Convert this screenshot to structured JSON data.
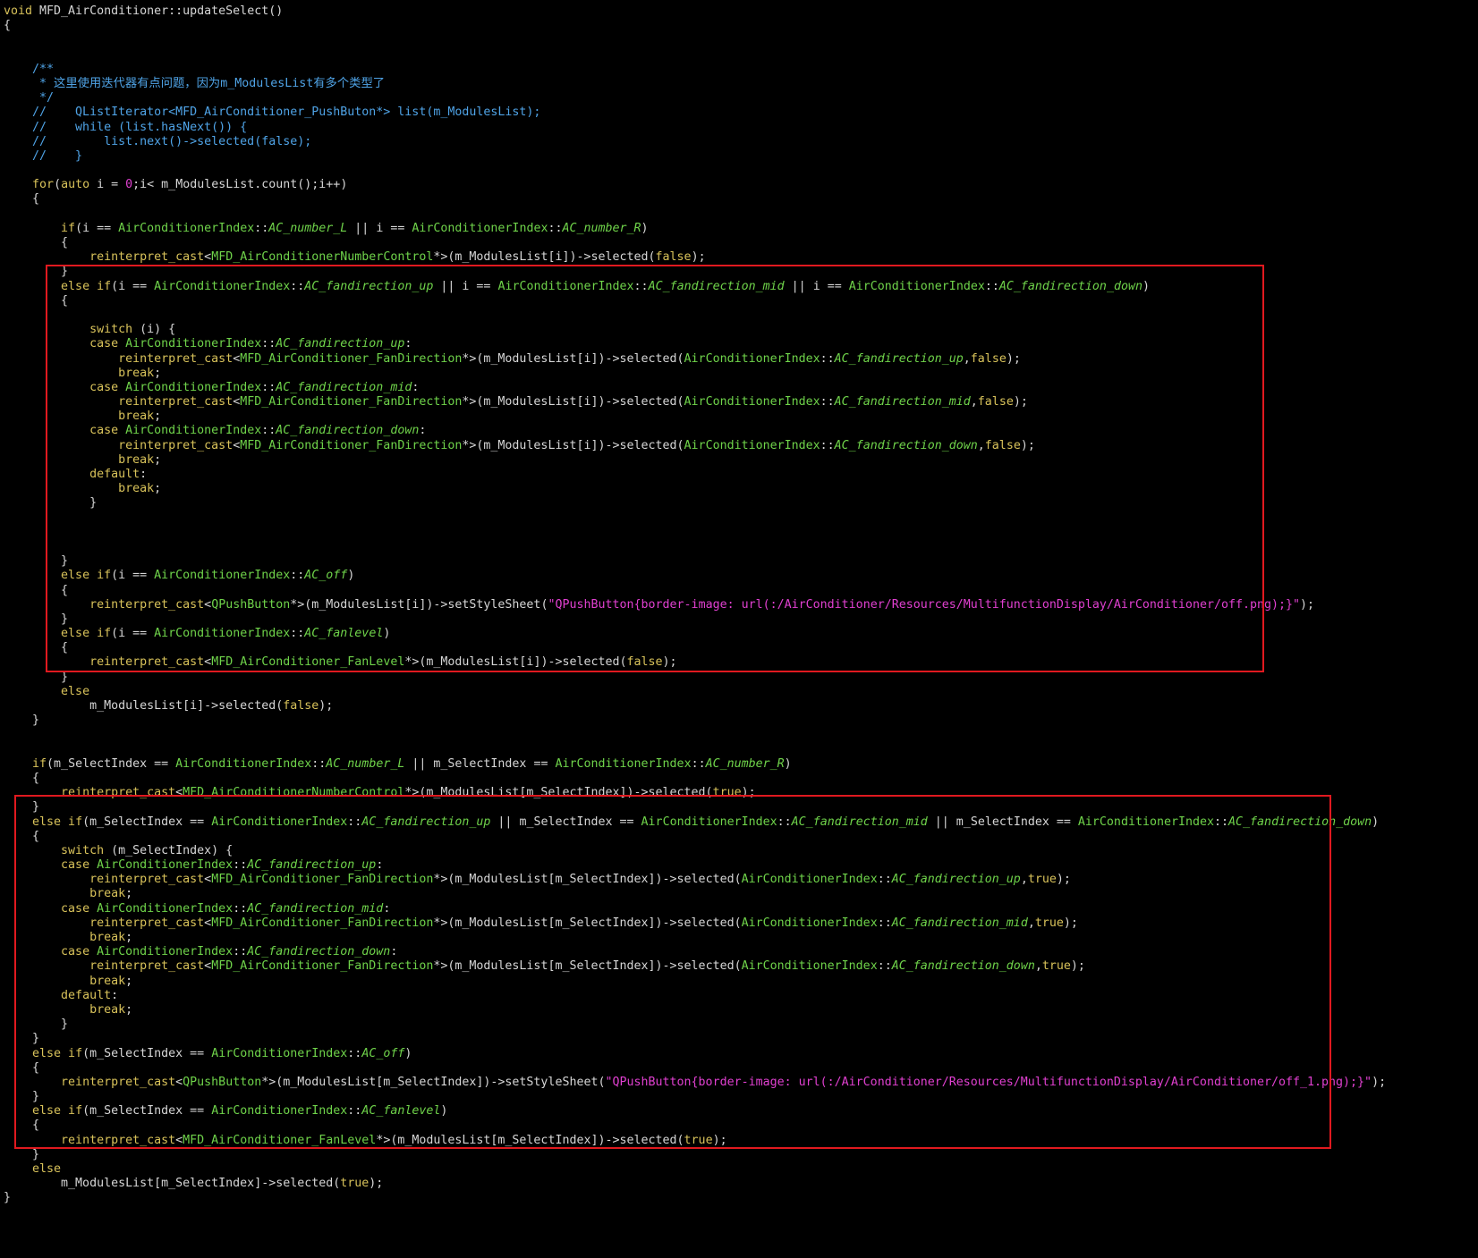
{
  "colors": {
    "background": "#000000",
    "highlight": "#e0191f",
    "keyword": "#d8c25a",
    "type": "#6fd34a",
    "comment": "#4fa3e6",
    "string": "#e040d0",
    "plain": "#d6d6d6"
  },
  "lines": [
    [
      [
        "kw",
        "void "
      ],
      [
        "pl",
        "MFD_AirConditioner::updateSelect()"
      ]
    ],
    [
      [
        "pl",
        "{"
      ]
    ],
    [],
    [],
    [
      [
        "cm",
        "    /**"
      ]
    ],
    [
      [
        "cm",
        "     * 这里使用迭代器有点问题，因为m_ModulesList有多个类型了"
      ]
    ],
    [
      [
        "cm",
        "     */"
      ]
    ],
    [
      [
        "cm",
        "    //    QListIterator<MFD_AirConditioner_PushButon*> list(m_ModulesList);"
      ]
    ],
    [
      [
        "cm",
        "    //    while (list.hasNext()) {"
      ]
    ],
    [
      [
        "cm",
        "    //        list.next()->selected(false);"
      ]
    ],
    [
      [
        "cm",
        "    //    }"
      ]
    ],
    [],
    [
      [
        "pl",
        "    "
      ],
      [
        "kw",
        "for"
      ],
      [
        "pl",
        "("
      ],
      [
        "kw",
        "auto "
      ],
      [
        "pl",
        "i = "
      ],
      [
        "nm",
        "0"
      ],
      [
        "pl",
        ";i< m_ModulesList.count();i++)"
      ]
    ],
    [
      [
        "pl",
        "    {"
      ]
    ],
    [],
    [
      [
        "pl",
        "        "
      ],
      [
        "kw",
        "if"
      ],
      [
        "pl",
        "(i == "
      ],
      [
        "ty",
        "AirConditionerIndex"
      ],
      [
        "pl",
        "::"
      ],
      [
        "it",
        "AC_number_L"
      ],
      [
        "pl",
        " || i == "
      ],
      [
        "ty",
        "AirConditionerIndex"
      ],
      [
        "pl",
        "::"
      ],
      [
        "it",
        "AC_number_R"
      ],
      [
        "pl",
        ")"
      ]
    ],
    [
      [
        "pl",
        "        {"
      ]
    ],
    [
      [
        "pl",
        "            "
      ],
      [
        "kw",
        "reinterpret_cast"
      ],
      [
        "pl",
        "<"
      ],
      [
        "ty",
        "MFD_AirConditionerNumberControl"
      ],
      [
        "pl",
        "*>(m_ModulesList[i])->selected("
      ],
      [
        "kw",
        "false"
      ],
      [
        "pl",
        ");"
      ]
    ],
    [
      [
        "pl",
        "        }"
      ]
    ],
    [
      [
        "pl",
        "        "
      ],
      [
        "kw",
        "else if"
      ],
      [
        "pl",
        "(i == "
      ],
      [
        "ty",
        "AirConditionerIndex"
      ],
      [
        "pl",
        "::"
      ],
      [
        "it",
        "AC_fandirection_up"
      ],
      [
        "pl",
        " || i == "
      ],
      [
        "ty",
        "AirConditionerIndex"
      ],
      [
        "pl",
        "::"
      ],
      [
        "it",
        "AC_fandirection_mid"
      ],
      [
        "pl",
        " || i == "
      ],
      [
        "ty",
        "AirConditionerIndex"
      ],
      [
        "pl",
        "::"
      ],
      [
        "it",
        "AC_fandirection_down"
      ],
      [
        "pl",
        ")"
      ]
    ],
    [
      [
        "pl",
        "        {"
      ]
    ],
    [],
    [
      [
        "pl",
        "            "
      ],
      [
        "kw",
        "switch"
      ],
      [
        "pl",
        " (i) {"
      ]
    ],
    [
      [
        "pl",
        "            "
      ],
      [
        "kw",
        "case "
      ],
      [
        "ty",
        "AirConditionerIndex"
      ],
      [
        "pl",
        "::"
      ],
      [
        "it",
        "AC_fandirection_up"
      ],
      [
        "pl",
        ":"
      ]
    ],
    [
      [
        "pl",
        "                "
      ],
      [
        "kw",
        "reinterpret_cast"
      ],
      [
        "pl",
        "<"
      ],
      [
        "ty",
        "MFD_AirConditioner_FanDirection"
      ],
      [
        "pl",
        "*>(m_ModulesList[i])->selected("
      ],
      [
        "ty",
        "AirConditionerIndex"
      ],
      [
        "pl",
        "::"
      ],
      [
        "it",
        "AC_fandirection_up"
      ],
      [
        "pl",
        ","
      ],
      [
        "kw",
        "false"
      ],
      [
        "pl",
        ");"
      ]
    ],
    [
      [
        "pl",
        "                "
      ],
      [
        "kw",
        "break"
      ],
      [
        "pl",
        ";"
      ]
    ],
    [
      [
        "pl",
        "            "
      ],
      [
        "kw",
        "case "
      ],
      [
        "ty",
        "AirConditionerIndex"
      ],
      [
        "pl",
        "::"
      ],
      [
        "it",
        "AC_fandirection_mid"
      ],
      [
        "pl",
        ":"
      ]
    ],
    [
      [
        "pl",
        "                "
      ],
      [
        "kw",
        "reinterpret_cast"
      ],
      [
        "pl",
        "<"
      ],
      [
        "ty",
        "MFD_AirConditioner_FanDirection"
      ],
      [
        "pl",
        "*>(m_ModulesList[i])->selected("
      ],
      [
        "ty",
        "AirConditionerIndex"
      ],
      [
        "pl",
        "::"
      ],
      [
        "it",
        "AC_fandirection_mid"
      ],
      [
        "pl",
        ","
      ],
      [
        "kw",
        "false"
      ],
      [
        "pl",
        ");"
      ]
    ],
    [
      [
        "pl",
        "                "
      ],
      [
        "kw",
        "break"
      ],
      [
        "pl",
        ";"
      ]
    ],
    [
      [
        "pl",
        "            "
      ],
      [
        "kw",
        "case "
      ],
      [
        "ty",
        "AirConditionerIndex"
      ],
      [
        "pl",
        "::"
      ],
      [
        "it",
        "AC_fandirection_down"
      ],
      [
        "pl",
        ":"
      ]
    ],
    [
      [
        "pl",
        "                "
      ],
      [
        "kw",
        "reinterpret_cast"
      ],
      [
        "pl",
        "<"
      ],
      [
        "ty",
        "MFD_AirConditioner_FanDirection"
      ],
      [
        "pl",
        "*>(m_ModulesList[i])->selected("
      ],
      [
        "ty",
        "AirConditionerIndex"
      ],
      [
        "pl",
        "::"
      ],
      [
        "it",
        "AC_fandirection_down"
      ],
      [
        "pl",
        ","
      ],
      [
        "kw",
        "false"
      ],
      [
        "pl",
        ");"
      ]
    ],
    [
      [
        "pl",
        "                "
      ],
      [
        "kw",
        "break"
      ],
      [
        "pl",
        ";"
      ]
    ],
    [
      [
        "pl",
        "            "
      ],
      [
        "kw",
        "default"
      ],
      [
        "pl",
        ":"
      ]
    ],
    [
      [
        "pl",
        "                "
      ],
      [
        "kw",
        "break"
      ],
      [
        "pl",
        ";"
      ]
    ],
    [
      [
        "pl",
        "            }"
      ]
    ],
    [],
    [],
    [],
    [
      [
        "pl",
        "        }"
      ]
    ],
    [
      [
        "pl",
        "        "
      ],
      [
        "kw",
        "else if"
      ],
      [
        "pl",
        "(i == "
      ],
      [
        "ty",
        "AirConditionerIndex"
      ],
      [
        "pl",
        "::"
      ],
      [
        "it",
        "AC_off"
      ],
      [
        "pl",
        ")"
      ]
    ],
    [
      [
        "pl",
        "        {"
      ]
    ],
    [
      [
        "pl",
        "            "
      ],
      [
        "kw",
        "reinterpret_cast"
      ],
      [
        "pl",
        "<"
      ],
      [
        "ty",
        "QPushButton"
      ],
      [
        "pl",
        "*>(m_ModulesList[i])->setStyleSheet("
      ],
      [
        "st",
        "\"QPushButton{border-image: url(:/AirConditioner/Resources/MultifunctionDisplay/AirConditioner/off.png);}\""
      ],
      [
        "pl",
        ");"
      ]
    ],
    [
      [
        "pl",
        "        }"
      ]
    ],
    [
      [
        "pl",
        "        "
      ],
      [
        "kw",
        "else if"
      ],
      [
        "pl",
        "(i == "
      ],
      [
        "ty",
        "AirConditionerIndex"
      ],
      [
        "pl",
        "::"
      ],
      [
        "it",
        "AC_fanlevel"
      ],
      [
        "pl",
        ")"
      ]
    ],
    [
      [
        "pl",
        "        {"
      ]
    ],
    [
      [
        "pl",
        "            "
      ],
      [
        "kw",
        "reinterpret_cast"
      ],
      [
        "pl",
        "<"
      ],
      [
        "ty",
        "MFD_AirConditioner_FanLevel"
      ],
      [
        "pl",
        "*>(m_ModulesList[i])->selected("
      ],
      [
        "kw",
        "false"
      ],
      [
        "pl",
        ");"
      ]
    ],
    [
      [
        "pl",
        "        }"
      ]
    ],
    [
      [
        "pl",
        "        "
      ],
      [
        "kw",
        "else"
      ]
    ],
    [
      [
        "pl",
        "            m_ModulesList[i]->selected("
      ],
      [
        "kw",
        "false"
      ],
      [
        "pl",
        ");"
      ]
    ],
    [
      [
        "pl",
        "    }"
      ]
    ],
    [],
    [],
    [
      [
        "pl",
        "    "
      ],
      [
        "kw",
        "if"
      ],
      [
        "pl",
        "(m_SelectIndex == "
      ],
      [
        "ty",
        "AirConditionerIndex"
      ],
      [
        "pl",
        "::"
      ],
      [
        "it",
        "AC_number_L"
      ],
      [
        "pl",
        " || m_SelectIndex == "
      ],
      [
        "ty",
        "AirConditionerIndex"
      ],
      [
        "pl",
        "::"
      ],
      [
        "it",
        "AC_number_R"
      ],
      [
        "pl",
        ")"
      ]
    ],
    [
      [
        "pl",
        "    {"
      ]
    ],
    [
      [
        "pl",
        "        "
      ],
      [
        "kw",
        "reinterpret_cast"
      ],
      [
        "pl",
        "<"
      ],
      [
        "ty",
        "MFD_AirConditionerNumberControl"
      ],
      [
        "pl",
        "*>(m_ModulesList[m_SelectIndex])->selected("
      ],
      [
        "kw",
        "true"
      ],
      [
        "pl",
        ");"
      ]
    ],
    [
      [
        "pl",
        "    }"
      ]
    ],
    [
      [
        "pl",
        "    "
      ],
      [
        "kw",
        "else if"
      ],
      [
        "pl",
        "(m_SelectIndex == "
      ],
      [
        "ty",
        "AirConditionerIndex"
      ],
      [
        "pl",
        "::"
      ],
      [
        "it",
        "AC_fandirection_up"
      ],
      [
        "pl",
        " || m_SelectIndex == "
      ],
      [
        "ty",
        "AirConditionerIndex"
      ],
      [
        "pl",
        "::"
      ],
      [
        "it",
        "AC_fandirection_mid"
      ],
      [
        "pl",
        " || m_SelectIndex == "
      ],
      [
        "ty",
        "AirConditionerIndex"
      ],
      [
        "pl",
        "::"
      ],
      [
        "it",
        "AC_fandirection_down"
      ],
      [
        "pl",
        ")"
      ]
    ],
    [
      [
        "pl",
        "    {"
      ]
    ],
    [
      [
        "pl",
        "        "
      ],
      [
        "kw",
        "switch"
      ],
      [
        "pl",
        " (m_SelectIndex) {"
      ]
    ],
    [
      [
        "pl",
        "        "
      ],
      [
        "kw",
        "case "
      ],
      [
        "ty",
        "AirConditionerIndex"
      ],
      [
        "pl",
        "::"
      ],
      [
        "it",
        "AC_fandirection_up"
      ],
      [
        "pl",
        ":"
      ]
    ],
    [
      [
        "pl",
        "            "
      ],
      [
        "kw",
        "reinterpret_cast"
      ],
      [
        "pl",
        "<"
      ],
      [
        "ty",
        "MFD_AirConditioner_FanDirection"
      ],
      [
        "pl",
        "*>(m_ModulesList[m_SelectIndex])->selected("
      ],
      [
        "ty",
        "AirConditionerIndex"
      ],
      [
        "pl",
        "::"
      ],
      [
        "it",
        "AC_fandirection_up"
      ],
      [
        "pl",
        ","
      ],
      [
        "kw",
        "true"
      ],
      [
        "pl",
        ");"
      ]
    ],
    [
      [
        "pl",
        "            "
      ],
      [
        "kw",
        "break"
      ],
      [
        "pl",
        ";"
      ]
    ],
    [
      [
        "pl",
        "        "
      ],
      [
        "kw",
        "case "
      ],
      [
        "ty",
        "AirConditionerIndex"
      ],
      [
        "pl",
        "::"
      ],
      [
        "it",
        "AC_fandirection_mid"
      ],
      [
        "pl",
        ":"
      ]
    ],
    [
      [
        "pl",
        "            "
      ],
      [
        "kw",
        "reinterpret_cast"
      ],
      [
        "pl",
        "<"
      ],
      [
        "ty",
        "MFD_AirConditioner_FanDirection"
      ],
      [
        "pl",
        "*>(m_ModulesList[m_SelectIndex])->selected("
      ],
      [
        "ty",
        "AirConditionerIndex"
      ],
      [
        "pl",
        "::"
      ],
      [
        "it",
        "AC_fandirection_mid"
      ],
      [
        "pl",
        ","
      ],
      [
        "kw",
        "true"
      ],
      [
        "pl",
        ");"
      ]
    ],
    [
      [
        "pl",
        "            "
      ],
      [
        "kw",
        "break"
      ],
      [
        "pl",
        ";"
      ]
    ],
    [
      [
        "pl",
        "        "
      ],
      [
        "kw",
        "case "
      ],
      [
        "ty",
        "AirConditionerIndex"
      ],
      [
        "pl",
        "::"
      ],
      [
        "it",
        "AC_fandirection_down"
      ],
      [
        "pl",
        ":"
      ]
    ],
    [
      [
        "pl",
        "            "
      ],
      [
        "kw",
        "reinterpret_cast"
      ],
      [
        "pl",
        "<"
      ],
      [
        "ty",
        "MFD_AirConditioner_FanDirection"
      ],
      [
        "pl",
        "*>(m_ModulesList[m_SelectIndex])->selected("
      ],
      [
        "ty",
        "AirConditionerIndex"
      ],
      [
        "pl",
        "::"
      ],
      [
        "it",
        "AC_fandirection_down"
      ],
      [
        "pl",
        ","
      ],
      [
        "kw",
        "true"
      ],
      [
        "pl",
        ");"
      ]
    ],
    [
      [
        "pl",
        "            "
      ],
      [
        "kw",
        "break"
      ],
      [
        "pl",
        ";"
      ]
    ],
    [
      [
        "pl",
        "        "
      ],
      [
        "kw",
        "default"
      ],
      [
        "pl",
        ":"
      ]
    ],
    [
      [
        "pl",
        "            "
      ],
      [
        "kw",
        "break"
      ],
      [
        "pl",
        ";"
      ]
    ],
    [
      [
        "pl",
        "        }"
      ]
    ],
    [
      [
        "pl",
        "    }"
      ]
    ],
    [
      [
        "pl",
        "    "
      ],
      [
        "kw",
        "else if"
      ],
      [
        "pl",
        "(m_SelectIndex == "
      ],
      [
        "ty",
        "AirConditionerIndex"
      ],
      [
        "pl",
        "::"
      ],
      [
        "it",
        "AC_off"
      ],
      [
        "pl",
        ")"
      ]
    ],
    [
      [
        "pl",
        "    {"
      ]
    ],
    [
      [
        "pl",
        "        "
      ],
      [
        "kw",
        "reinterpret_cast"
      ],
      [
        "pl",
        "<"
      ],
      [
        "ty",
        "QPushButton"
      ],
      [
        "pl",
        "*>(m_ModulesList[m_SelectIndex])->setStyleSheet("
      ],
      [
        "st",
        "\"QPushButton{border-image: url(:/AirConditioner/Resources/MultifunctionDisplay/AirConditioner/off_1.png);}\""
      ],
      [
        "pl",
        ");"
      ]
    ],
    [
      [
        "pl",
        "    }"
      ]
    ],
    [
      [
        "pl",
        "    "
      ],
      [
        "kw",
        "else if"
      ],
      [
        "pl",
        "(m_SelectIndex == "
      ],
      [
        "ty",
        "AirConditionerIndex"
      ],
      [
        "pl",
        "::"
      ],
      [
        "it",
        "AC_fanlevel"
      ],
      [
        "pl",
        ")"
      ]
    ],
    [
      [
        "pl",
        "    {"
      ]
    ],
    [
      [
        "pl",
        "        "
      ],
      [
        "kw",
        "reinterpret_cast"
      ],
      [
        "pl",
        "<"
      ],
      [
        "ty",
        "MFD_AirConditioner_FanLevel"
      ],
      [
        "pl",
        "*>(m_ModulesList[m_SelectIndex])->selected("
      ],
      [
        "kw",
        "true"
      ],
      [
        "pl",
        ");"
      ]
    ],
    [
      [
        "pl",
        "    }"
      ]
    ],
    [
      [
        "pl",
        "    "
      ],
      [
        "kw",
        "else"
      ]
    ],
    [
      [
        "pl",
        "        m_ModulesList[m_SelectIndex]->selected("
      ],
      [
        "kw",
        "true"
      ],
      [
        "pl",
        ");"
      ]
    ],
    [
      [
        "pl",
        "}"
      ]
    ]
  ]
}
